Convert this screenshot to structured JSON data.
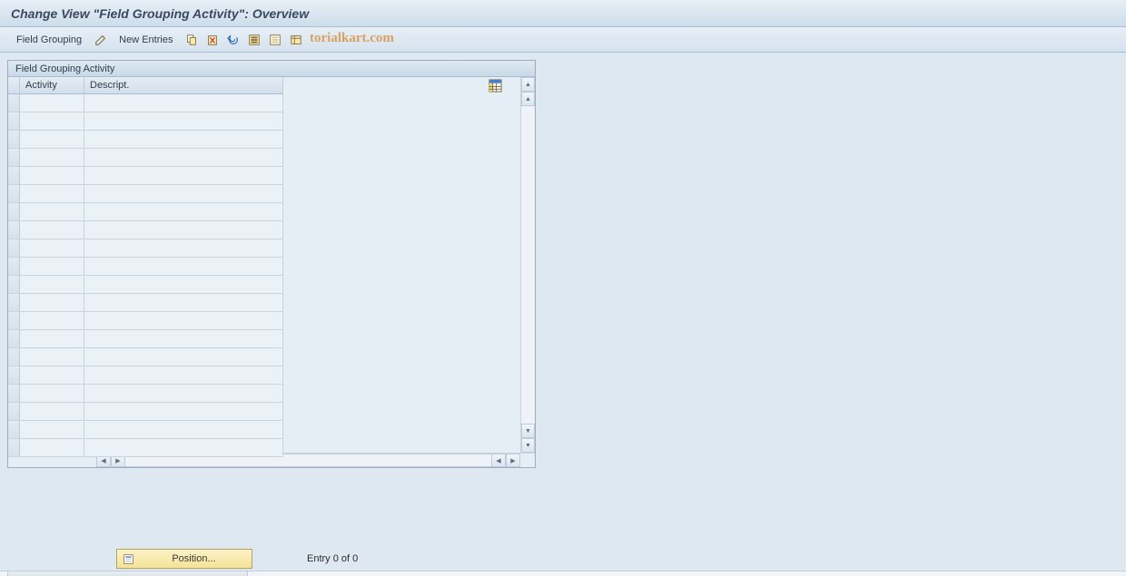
{
  "title": "Change View \"Field Grouping Activity\": Overview",
  "toolbar": {
    "field_grouping_label": "Field Grouping",
    "new_entries_label": "New Entries"
  },
  "watermark": "torialkart.com",
  "panel": {
    "title": "Field Grouping Activity",
    "columns": {
      "activity": "Activity",
      "descript": "Descript."
    },
    "row_count": 20
  },
  "footer": {
    "position_button": "Position...",
    "entry_status": "Entry 0 of 0"
  }
}
